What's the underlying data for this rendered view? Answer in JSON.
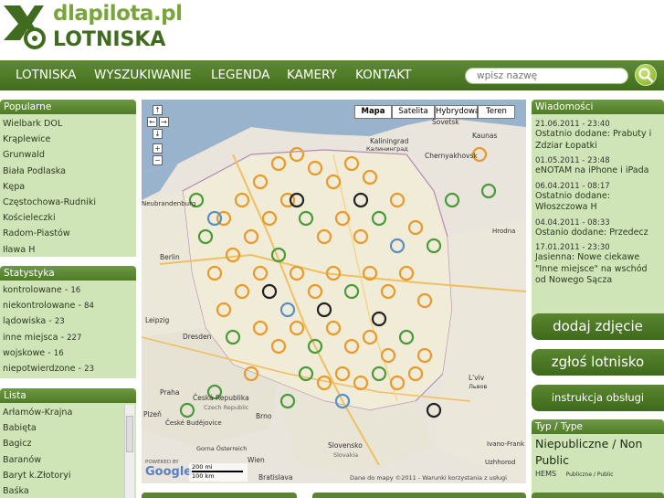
{
  "brand": {
    "top": "dlapilota.pl",
    "bottom": "LOTNISKA"
  },
  "nav": {
    "items": [
      "LOTNISKA",
      "WYSZUKIWANIE",
      "LEGENDA",
      "KAMERY",
      "KONTAKT"
    ],
    "search_placeholder": "wpisz nazwę"
  },
  "popularne": {
    "title": "Popularne",
    "items": [
      "Wielbark DOL",
      "Krąplewice",
      "Grunwald",
      "Biała Podlaska",
      "Kępa",
      "Częstochowa-Rudniki",
      "Kościeleczki",
      "Radom-Piastów",
      "Iława H"
    ]
  },
  "statystyka": {
    "title": "Statystyka",
    "items": [
      {
        "label": "kontrolowane",
        "count": "16"
      },
      {
        "label": "niekontrolowane",
        "count": "84"
      },
      {
        "label": "lądowiska",
        "count": "23"
      },
      {
        "label": "inne miejsca",
        "count": "227"
      },
      {
        "label": "wojskowe",
        "count": "16"
      },
      {
        "label": "niepotwierdzone",
        "count": "23"
      }
    ]
  },
  "lista": {
    "title": "Lista",
    "items": [
      "Arłamów-Krajna",
      "Babięta",
      "Bagicz",
      "Baranów",
      "Baryt k.Złotoryi",
      "Baśka"
    ]
  },
  "map": {
    "types": [
      "Mapa",
      "Satelita",
      "Hybrydowa",
      "Teren"
    ],
    "selected": "Mapa",
    "labels": {
      "kaliningrad": "Kaliningrad",
      "kaliningrad_ru": "Калининград",
      "chernyakhovsk": "Chernyakhovsk",
      "sovetsk": "Sovetsk",
      "kaunas": "Kaunas",
      "neubrandenburg": "Neubrandenburg",
      "berlin": "Berlin",
      "leipzig": "Leipzig",
      "dresden": "Dresden",
      "ceska": "Česká Republika",
      "czech": "Czech Republic",
      "brno": "Brno",
      "praha": "Praha",
      "plzen": "Plzeň",
      "budejovice": "České Budějovice",
      "wien": "Wien",
      "bratislava": "Bratislava",
      "slovensko": "Slovensko",
      "slovakia": "Slovakia",
      "lviv": "L'viv",
      "lvov": "Львов",
      "ivano": "Ivano-Frank",
      "uzhhorod": "Uzhhorod",
      "grodno": "Hrodna",
      "gorna": "Gorna Österreich",
      "powered": "POWERED BY",
      "scale_mi": "200 mi",
      "scale_km": "100 km",
      "copyright": "Dane do mapy ©2011 - Warunki korzystania z usługi"
    }
  },
  "wiadomosci": {
    "title": "Wiadomości",
    "items": [
      {
        "date": "21.06.2011 - 23:40",
        "text": "Ostatnio dodane: Prabuty i Zdziar Łopatki"
      },
      {
        "date": "01.05.2011 - 23:48",
        "text": "eNOTAM na iPhone i iPada"
      },
      {
        "date": "06.04.2011 - 08:17",
        "text": "Ostatnio dodane: Włoszczowa H"
      },
      {
        "date": "04.04.2011 - 08:33",
        "text": "Ostanio dodane: Przedecz"
      },
      {
        "date": "17.01.2011 - 23:30",
        "text": "Jasienna: Nowe ciekawe \"Inne miejsce\" na wschód od Nowego Sącza"
      }
    ]
  },
  "actions": {
    "add_photo": "dodaj zdjęcie",
    "report": "zgłoś lotnisko",
    "help": "instrukcja obsługi"
  },
  "typ": {
    "title": "Typ / Type",
    "value": "Niepubliczne / Non Public",
    "code": "HEMS",
    "code_desc": "Publiczne / Public"
  },
  "colors": {
    "accent": "#4f7a27",
    "panel_bg": "#cfe4b7",
    "brand_light": "#7aa53a",
    "brand_dark": "#3f6c1e"
  }
}
